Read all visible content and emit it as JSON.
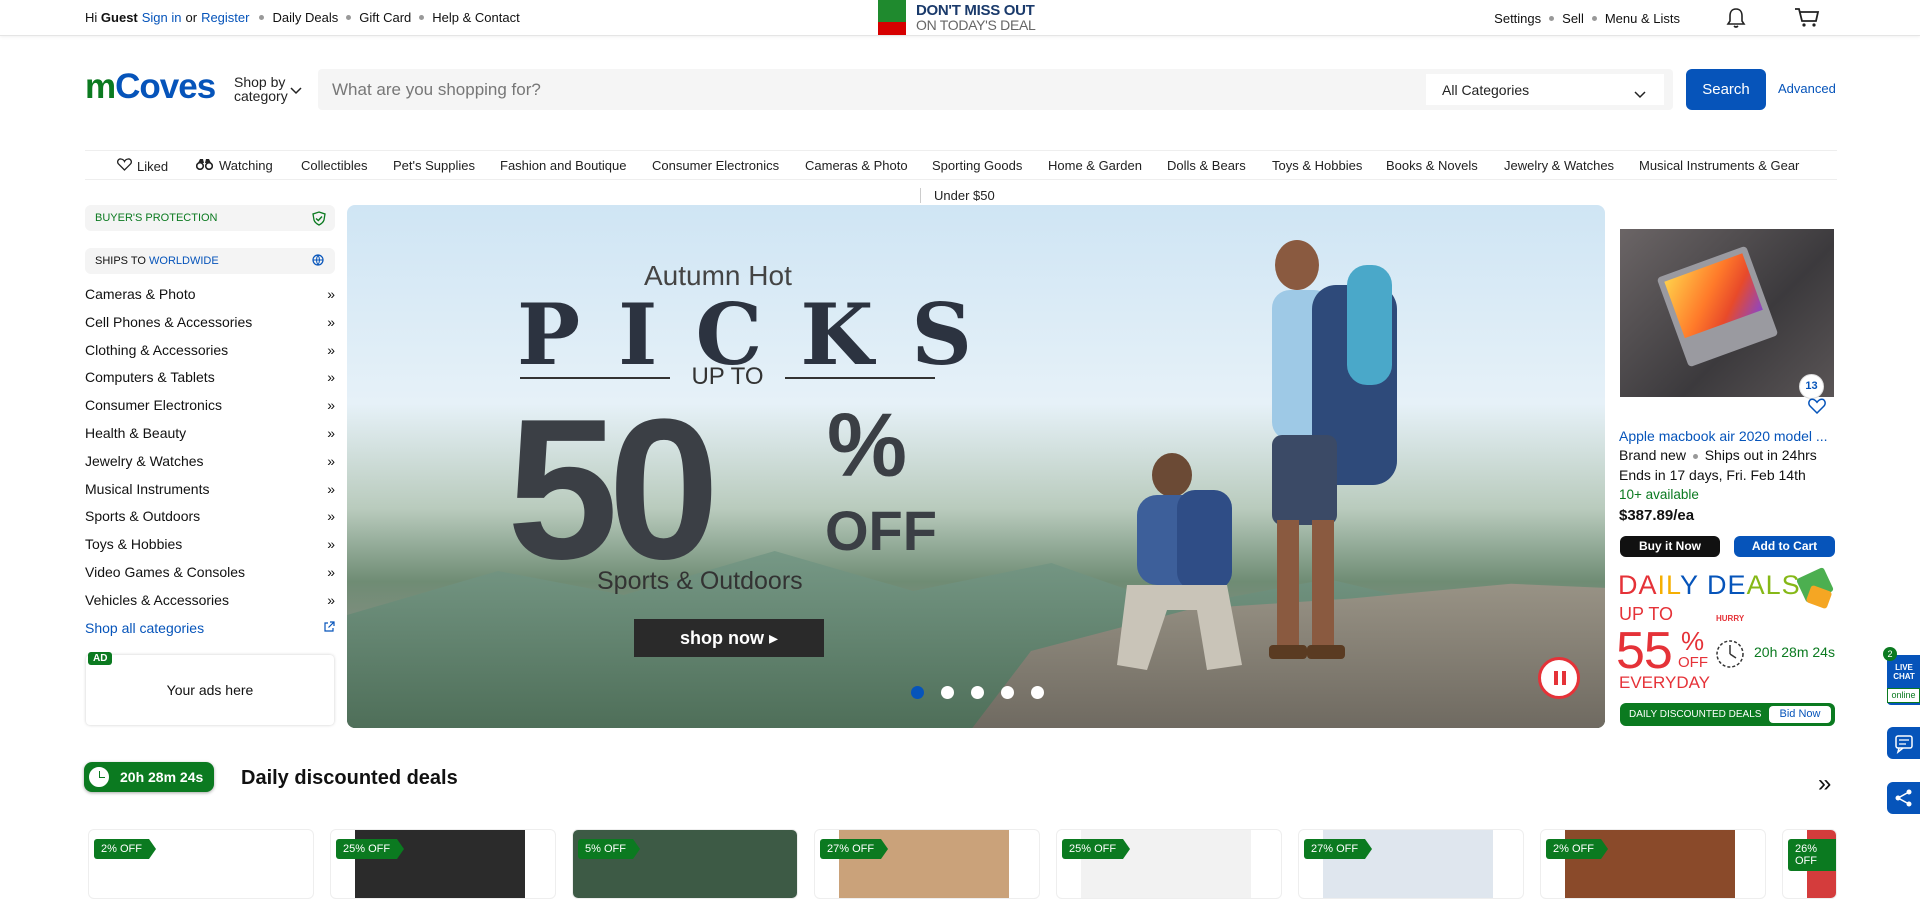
{
  "topbar": {
    "greeting_hi": "Hi",
    "greeting_user": "Guest",
    "sign_in": "Sign in",
    "or": "or",
    "register": "Register",
    "daily_deals": "Daily Deals",
    "gift_card": "Gift Card",
    "help": "Help & Contact",
    "promo_line1": "DON'T MISS OUT",
    "promo_line2": "ON TODAY'S DEAL",
    "settings": "Settings",
    "sell": "Sell",
    "menu_lists": "Menu & Lists",
    "icons": [
      "bell-icon",
      "cart-icon"
    ]
  },
  "header": {
    "logo_m": "m",
    "logo_c": "Coves",
    "shop_by_line1": "Shop by",
    "shop_by_line2": "category",
    "search_placeholder": "What are you shopping for?",
    "category_selected": "All Categories",
    "search_button": "Search",
    "advanced": "Advanced"
  },
  "nav": {
    "liked": "Liked",
    "watching": "Watching",
    "items": [
      "Collectibles",
      "Pet's Supplies",
      "Fashion and Boutique",
      "Consumer Electronics",
      "Cameras & Photo",
      "Sporting Goods",
      "Home & Garden",
      "Dolls & Bears",
      "Toys & Hobbies",
      "Books & Novels",
      "Jewelry & Watches",
      "Musical Instruments & Gear"
    ],
    "sub": "Under $50"
  },
  "sidebar": {
    "buyer_protection": "BUYER'S PROTECTION",
    "ships_to": "SHIPS TO",
    "worldwide": "WORLDWIDE",
    "categories": [
      "Cameras & Photo",
      "Cell Phones & Accessories",
      "Clothing & Accessories",
      "Computers & Tablets",
      "Consumer Electronics",
      "Health & Beauty",
      "Jewelry & Watches",
      "Musical Instruments",
      "Sports & Outdoors",
      "Toys & Hobbies",
      "Video Games & Consoles",
      "Vehicles & Accessories"
    ],
    "arrow": "»",
    "shop_all": "Shop all categories",
    "ad_tag": "AD",
    "ad_text": "Your ads here"
  },
  "hero": {
    "line1": "Autumn Hot",
    "line2": "PICKS",
    "line3": "UP TO",
    "percent_num": "50",
    "percent_sign": "%",
    "off": "OFF",
    "category": "Sports & Outdoors",
    "cta": "shop now ▸",
    "slides": 5,
    "active_slide": 1
  },
  "product": {
    "badge": "13",
    "title": "Apple macbook air 2020 model ...",
    "condition": "Brand new",
    "shipping": "Ships out in 24hrs",
    "ends": "Ends in 17 days, Fri. Feb 14th",
    "available": "10+ available",
    "price": "$387.89/ea",
    "buy_now": "Buy it Now",
    "add_to_cart": "Add to Cart"
  },
  "daily_deals_promo": {
    "title_parts": [
      "DA",
      "IL",
      "Y DE",
      "ALS"
    ],
    "upto": "UP TO",
    "value": "55",
    "pct": "%",
    "off": "OFF",
    "everyday": "EVERYDAY",
    "hurry": "HURRY",
    "timer": "20h 28m 24s",
    "bar_label": "DAILY DISCOUNTED DEALS",
    "bid_now": "Bid Now"
  },
  "livechat": {
    "count": "2",
    "label": "LIVE CHAT",
    "status": "online"
  },
  "deals_section": {
    "timer": "20h 28m 24s",
    "heading": "Daily discounted deals",
    "more": "»",
    "cards": [
      {
        "off": "2% OFF",
        "color": "#ffffff"
      },
      {
        "off": "25% OFF",
        "color": "#2b2b2b"
      },
      {
        "off": "5% OFF",
        "color": "#3d5a45"
      },
      {
        "off": "27% OFF",
        "color": "#caa27a"
      },
      {
        "off": "25% OFF",
        "color": "#f2f2f2"
      },
      {
        "off": "27% OFF",
        "color": "#dfe6ee"
      },
      {
        "off": "2% OFF",
        "color": "#8a4a2a"
      },
      {
        "off": "26% OFF",
        "color": "#d43c3c"
      }
    ]
  },
  "colors": {
    "brand_blue": "#0654ba",
    "brand_green": "#0b7a20",
    "accent_red": "#e53238"
  }
}
